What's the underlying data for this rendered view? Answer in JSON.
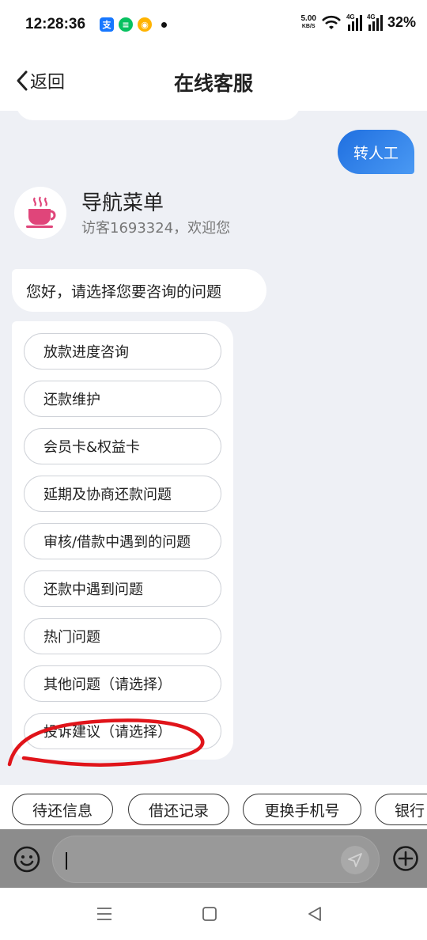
{
  "status_bar": {
    "time": "12:28:36",
    "speed_value": "5.00",
    "speed_unit": "KB/S",
    "signal_1": "4G",
    "signal_2": "4G",
    "battery": "32%"
  },
  "header": {
    "back_label": "返回",
    "title": "在线客服"
  },
  "chat": {
    "user_message": "转人工",
    "agent_name": "导航菜单",
    "agent_welcome": "访客1693324，欢迎您",
    "greeting": "您好，请选择您要咨询的问题",
    "menu_items": [
      "放款进度咨询",
      "还款维护",
      "会员卡&权益卡",
      "延期及协商还款问题",
      "审核/借款中遇到的问题",
      "还款中遇到问题",
      "热门问题",
      "其他问题（请选择）",
      "投诉建议（请选择）"
    ]
  },
  "quick_actions": [
    "待还信息",
    "借还记录",
    "更换手机号",
    "银行"
  ],
  "colors": {
    "accent": "#2f7ff0",
    "chat_background": "#eef0f5",
    "annotation": "#e0141a"
  }
}
